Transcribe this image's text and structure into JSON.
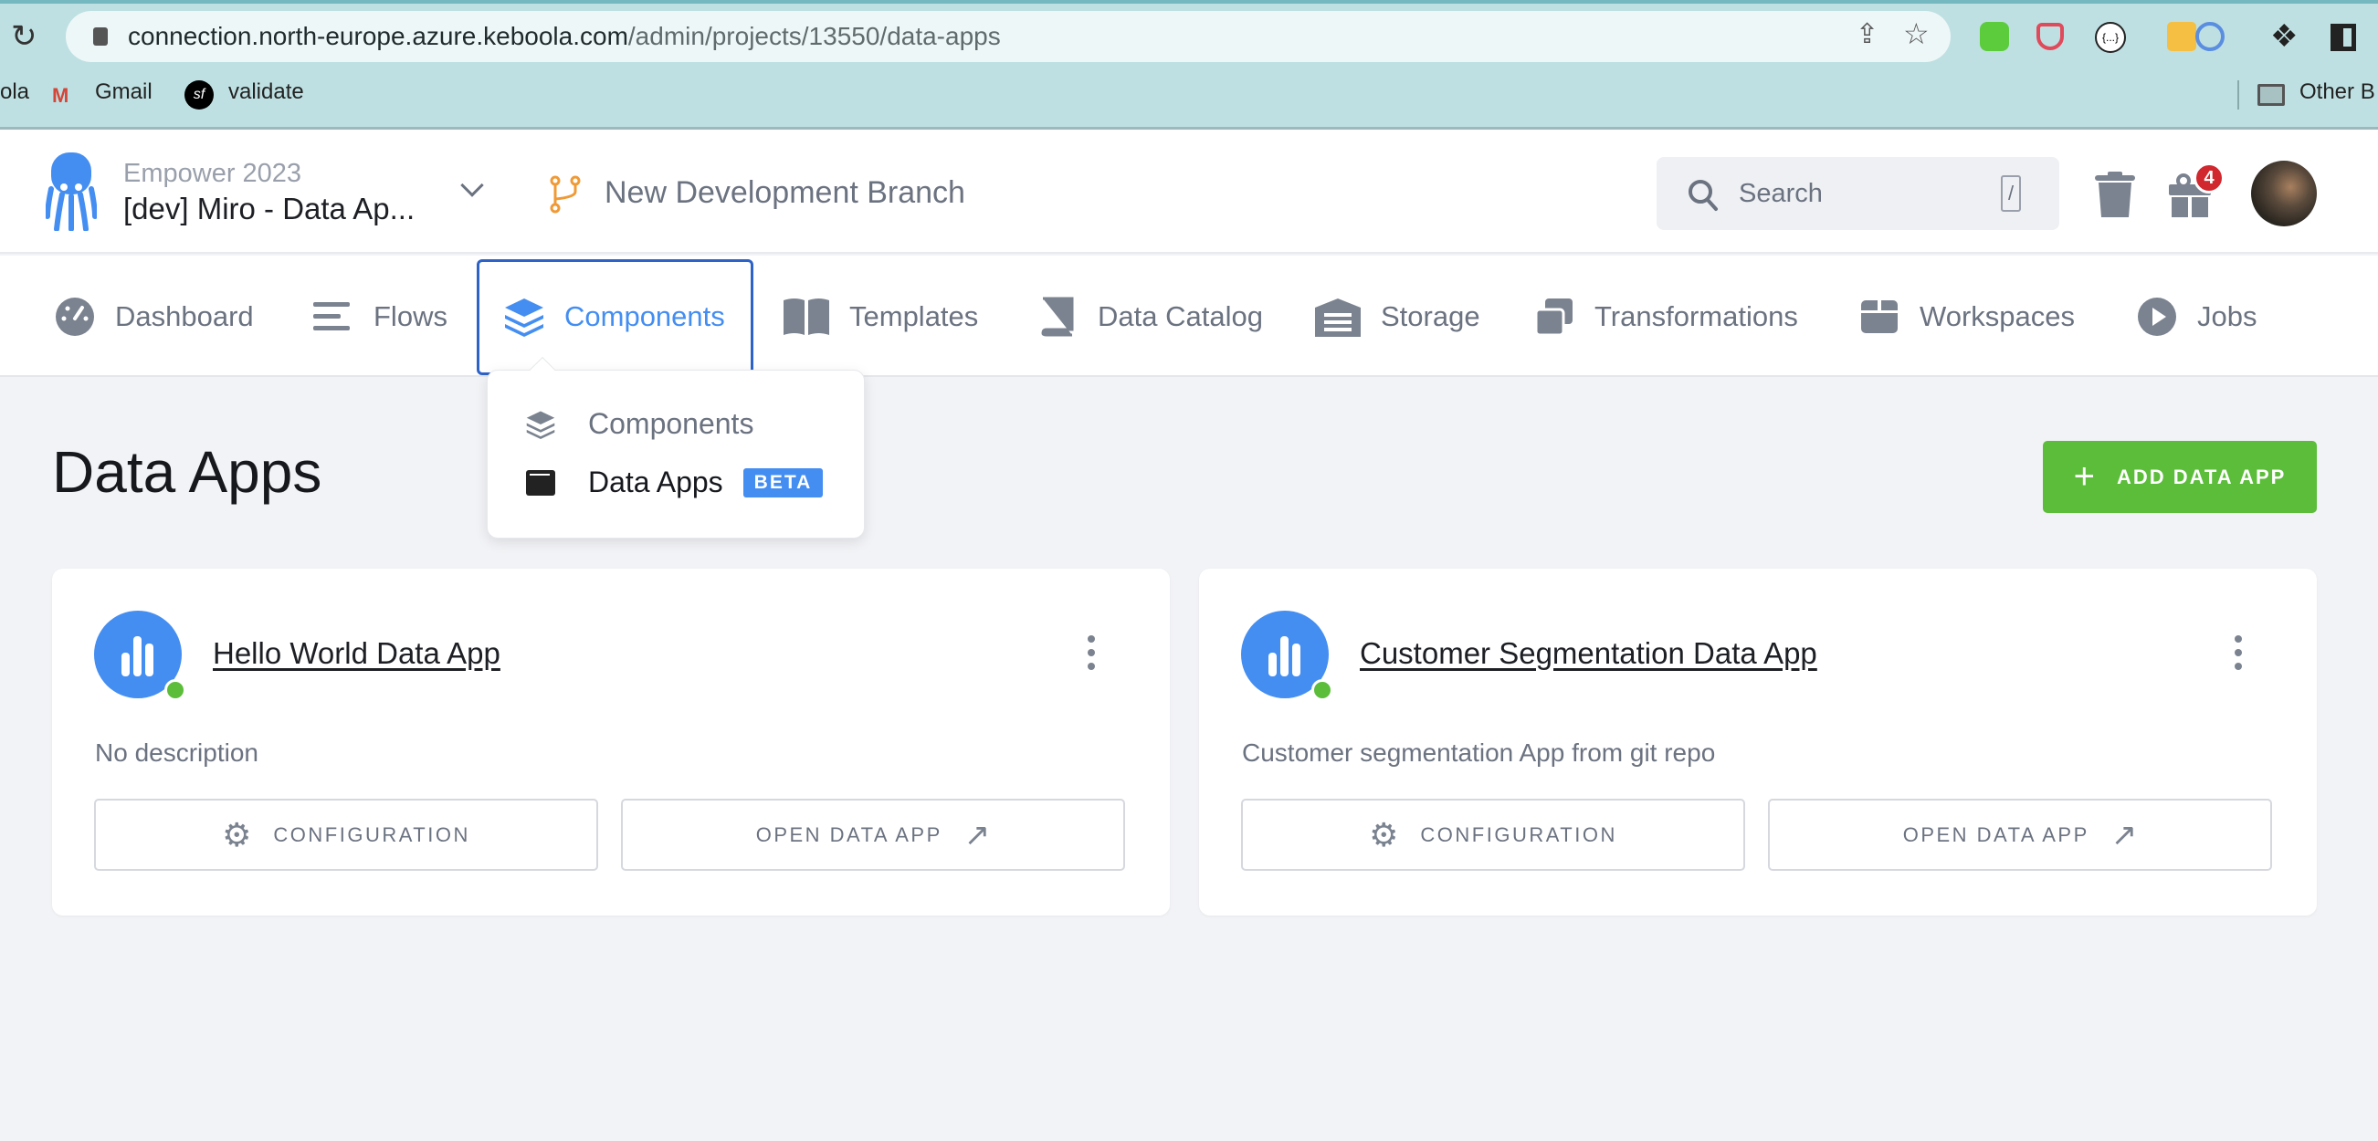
{
  "browser": {
    "url_host": "connection.north-europe.azure.keboola.com",
    "url_path": "/admin/projects/13550/data-apps",
    "bookmarks": [
      "ola",
      "Gmail",
      "validate"
    ],
    "other_bookmarks": "Other B"
  },
  "header": {
    "org": "Empower 2023",
    "project": "[dev] Miro - Data Ap...",
    "branch": "New Development Branch",
    "search_placeholder": "Search",
    "search_shortcut": "/",
    "notification_count": "4"
  },
  "nav": {
    "items": [
      "Dashboard",
      "Flows",
      "Components",
      "Templates",
      "Data Catalog",
      "Storage",
      "Transformations",
      "Workspaces",
      "Jobs"
    ],
    "active": "Components"
  },
  "dropdown": {
    "items": [
      "Components",
      "Data Apps"
    ],
    "badge": "BETA"
  },
  "page": {
    "title": "Data Apps",
    "add_button": "ADD DATA APP"
  },
  "apps": [
    {
      "name": "Hello World Data App",
      "description": "No description",
      "status": "running",
      "config_label": "CONFIGURATION",
      "open_label": "OPEN DATA APP"
    },
    {
      "name": "Customer Segmentation Data App",
      "description": "Customer segmentation App from git repo",
      "status": "running",
      "config_label": "CONFIGURATION",
      "open_label": "OPEN DATA APP"
    }
  ],
  "colors": {
    "accent": "#448ef2",
    "success": "#5bbd3a",
    "active_border": "#2d63c8",
    "badge": "#d0282e"
  }
}
